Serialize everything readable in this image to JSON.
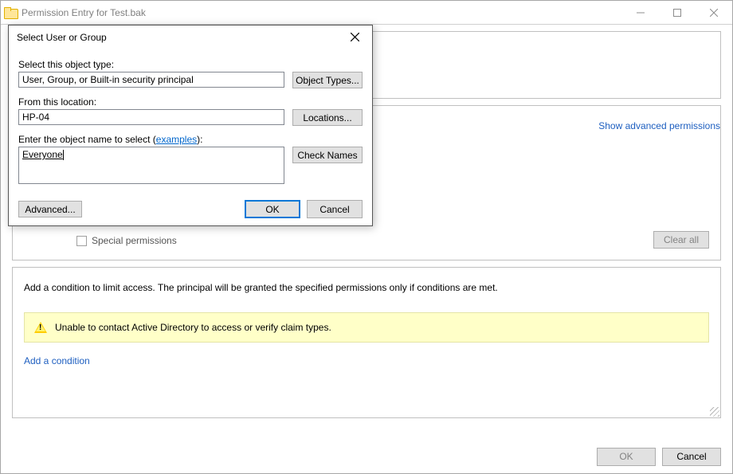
{
  "parent": {
    "title": "Permission Entry for Test.bak",
    "show_advanced": "Show advanced permissions",
    "special_permissions": "Special permissions",
    "clear_all": "Clear all",
    "condition_text": "Add a condition to limit access. The principal will be granted the specified permissions only if conditions are met.",
    "warning_text": "Unable to contact Active Directory to access or verify claim types.",
    "add_condition": "Add a condition",
    "ok": "OK",
    "cancel": "Cancel"
  },
  "dialog": {
    "title": "Select User or Group",
    "object_type_label": "Select this object type:",
    "object_type_value": "User, Group, or Built-in security principal",
    "object_types_btn": "Object Types...",
    "location_label": "From this location:",
    "location_value": "HP-04",
    "locations_btn": "Locations...",
    "enter_name_label_prefix": "Enter the object name to select (",
    "examples_link": "examples",
    "enter_name_label_suffix": "):",
    "object_name_value": "Everyone",
    "check_names_btn": "Check Names",
    "advanced_btn": "Advanced...",
    "ok": "OK",
    "cancel": "Cancel"
  }
}
